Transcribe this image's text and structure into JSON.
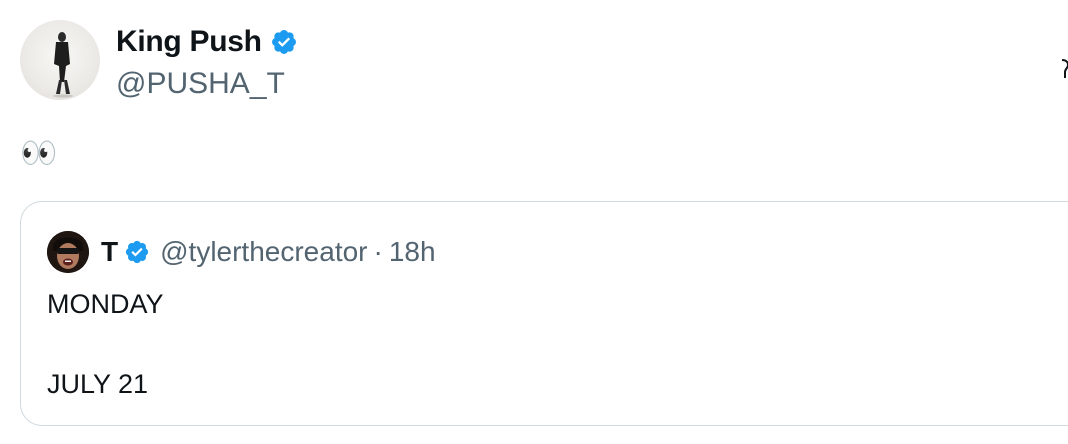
{
  "tweet": {
    "author": {
      "display_name": "King Push",
      "handle": "@PUSHA_T",
      "verified": true,
      "avatar_icon": "person-standing-avatar"
    },
    "text": "👀",
    "more_icon": "more-options-icon"
  },
  "quoted_tweet": {
    "author": {
      "display_name": "T",
      "handle": "@tylerthecreator",
      "verified": true,
      "avatar_icon": "face-avatar"
    },
    "separator": "·",
    "timestamp": "18h",
    "lines": [
      "MONDAY",
      "JULY 21"
    ]
  },
  "colors": {
    "text": "#0f1419",
    "secondary": "#536471",
    "verified_blue": "#1d9bf0",
    "border": "#cfd9de"
  }
}
